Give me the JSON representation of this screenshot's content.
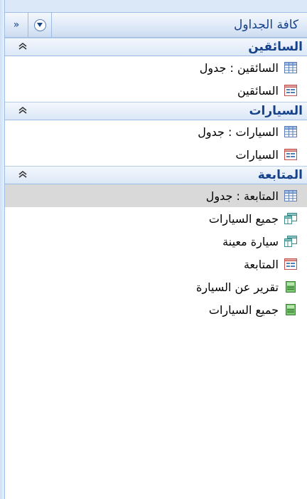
{
  "header": {
    "title": "كافة الجداول",
    "menu_icon": "chevron-down-circle-icon",
    "collapse_label": "»"
  },
  "groups": [
    {
      "title": "السائقين",
      "toggle": "≈",
      "items": [
        {
          "label": "السائقين : جدول",
          "icon": "table-icon"
        },
        {
          "label": "السائقين",
          "icon": "form-icon"
        }
      ]
    },
    {
      "title": "السيارات",
      "toggle": "≈",
      "items": [
        {
          "label": "السيارات : جدول",
          "icon": "table-icon"
        },
        {
          "label": "السيارات",
          "icon": "form-icon"
        }
      ]
    },
    {
      "title": "المتابعة",
      "toggle": "≈",
      "items": [
        {
          "label": "المتابعة : جدول",
          "icon": "table-icon",
          "selected": true
        },
        {
          "label": "جميع السيارات",
          "icon": "query-icon"
        },
        {
          "label": "سيارة معينة",
          "icon": "query-icon"
        },
        {
          "label": "المتابعة",
          "icon": "form-icon"
        },
        {
          "label": "تقرير عن السيارة",
          "icon": "report-icon"
        },
        {
          "label": "جميع السيارات",
          "icon": "report-icon"
        }
      ]
    }
  ]
}
